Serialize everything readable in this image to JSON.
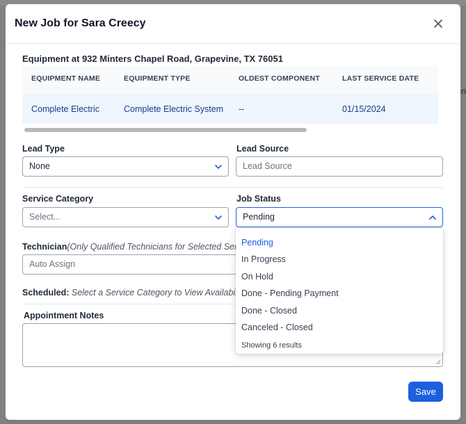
{
  "background": {
    "peek_right_top": "nn"
  },
  "modal": {
    "title": "New Job for Sara Creecy"
  },
  "equipment": {
    "heading": "Equipment at 932 Minters Chapel Road, Grapevine, TX 76051",
    "columns": [
      "EQUIPMENT NAME",
      "EQUIPMENT TYPE",
      "OLDEST COMPONENT",
      "LAST SERVICE DATE"
    ],
    "rows": [
      [
        "Complete Electric",
        "Complete Electric System",
        "--",
        "01/15/2024"
      ]
    ]
  },
  "form": {
    "lead_type": {
      "label": "Lead Type",
      "value": "None"
    },
    "lead_source": {
      "label": "Lead Source",
      "placeholder": "Lead Source"
    },
    "service_category": {
      "label": "Service Category",
      "placeholder": "Select..."
    },
    "job_status": {
      "label": "Job Status",
      "value": "Pending"
    },
    "technician": {
      "label": "Technician",
      "hint": "(Only Qualified Technicians for Selected Serv",
      "placeholder": "Auto Assign"
    },
    "scheduled": {
      "label": "Scheduled:",
      "hint": "Select a Service Category to View Availability"
    },
    "appointment_notes": {
      "label": "Appointment Notes"
    },
    "save_label": "Save"
  },
  "job_status_dropdown": {
    "options": [
      "Pending",
      "In Progress",
      "On Hold",
      "Done - Pending Payment",
      "Done - Closed",
      "Canceled - Closed"
    ],
    "selected_index": 0,
    "footer": "Showing 6 results"
  },
  "colors": {
    "primary": "#1d5fe0",
    "row_highlight": "#eef5fd",
    "link_text": "#1e3a8a"
  }
}
